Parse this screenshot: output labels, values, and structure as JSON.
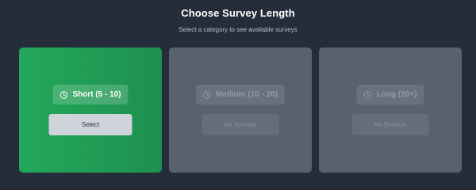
{
  "header": {
    "title": "Choose Survey Length",
    "subtitle": "Select a category to see available surveys"
  },
  "cards": [
    {
      "label": "Short (5 - 10)",
      "button_label": "Select",
      "icon": "clock-icon",
      "state": "active"
    },
    {
      "label": "Medium (10 - 20)",
      "button_label": "No Surveys",
      "icon": "clock-icon",
      "state": "disabled"
    },
    {
      "label": "Long (20+)",
      "button_label": "No Surveys",
      "icon": "clock-icon",
      "state": "disabled"
    }
  ],
  "colors": {
    "background": "#252c3a",
    "active_card": "#23a85a",
    "inactive_card": "#5a606e"
  }
}
